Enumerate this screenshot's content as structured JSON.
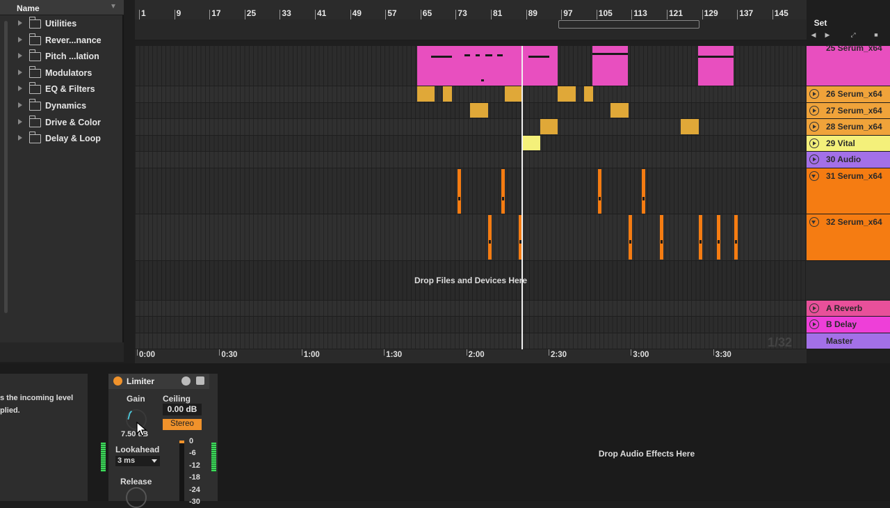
{
  "browser": {
    "header": "Name",
    "items": [
      {
        "label": "Utilities"
      },
      {
        "label": "Rever...nance"
      },
      {
        "label": "Pitch ...lation"
      },
      {
        "label": "Modulators"
      },
      {
        "label": "EQ & Filters"
      },
      {
        "label": "Dynamics"
      },
      {
        "label": "Drive & Color"
      },
      {
        "label": "Delay & Loop"
      }
    ]
  },
  "ruler": {
    "bars": [
      "1",
      "9",
      "17",
      "25",
      "33",
      "41",
      "49",
      "57",
      "65",
      "73",
      "81",
      "89",
      "97",
      "105",
      "113",
      "121",
      "129",
      "137",
      "145"
    ],
    "set_label": "Set"
  },
  "time_ruler": [
    "0:00",
    "0:30",
    "1:00",
    "1:30",
    "2:00",
    "2:30",
    "3:00",
    "3:30"
  ],
  "tracks": [
    {
      "name": "25 Serum_x64",
      "color": "#e84fbf"
    },
    {
      "name": "26 Serum_x64",
      "color": "#f0a33a"
    },
    {
      "name": "27 Serum_x64",
      "color": "#f0a33a"
    },
    {
      "name": "28 Serum_x64",
      "color": "#f0a33a"
    },
    {
      "name": "29 Vital",
      "color": "#f4f07a"
    },
    {
      "name": "30 Audio",
      "color": "#a370e8"
    },
    {
      "name": "31 Serum_x64",
      "color": "#f57c12"
    },
    {
      "name": "32 Serum_x64",
      "color": "#f57c12"
    }
  ],
  "returns": [
    {
      "name": "A Reverb",
      "color": "#e8509a"
    },
    {
      "name": "B Delay",
      "color": "#ee3fd8"
    },
    {
      "name": "Master",
      "color": "#a370e8"
    }
  ],
  "arrangement": {
    "drop_text": "Drop Files and Devices Here",
    "zoom_label": "1/32"
  },
  "info_panel": {
    "line1": "s the incoming level",
    "line2": "plied."
  },
  "device": {
    "name": "Limiter",
    "gain_label": "Gain",
    "gain_value": "7.50 dB",
    "ceiling_label": "Ceiling",
    "ceiling_value": "0.00 dB",
    "stereo_label": "Stereo",
    "lookahead_label": "Lookahead",
    "lookahead_value": "3 ms",
    "release_label": "Release",
    "meter_scale": [
      "0",
      "-6",
      "-12",
      "-18",
      "-24",
      "-30"
    ]
  },
  "effects": {
    "drop_text": "Drop Audio Effects Here"
  }
}
